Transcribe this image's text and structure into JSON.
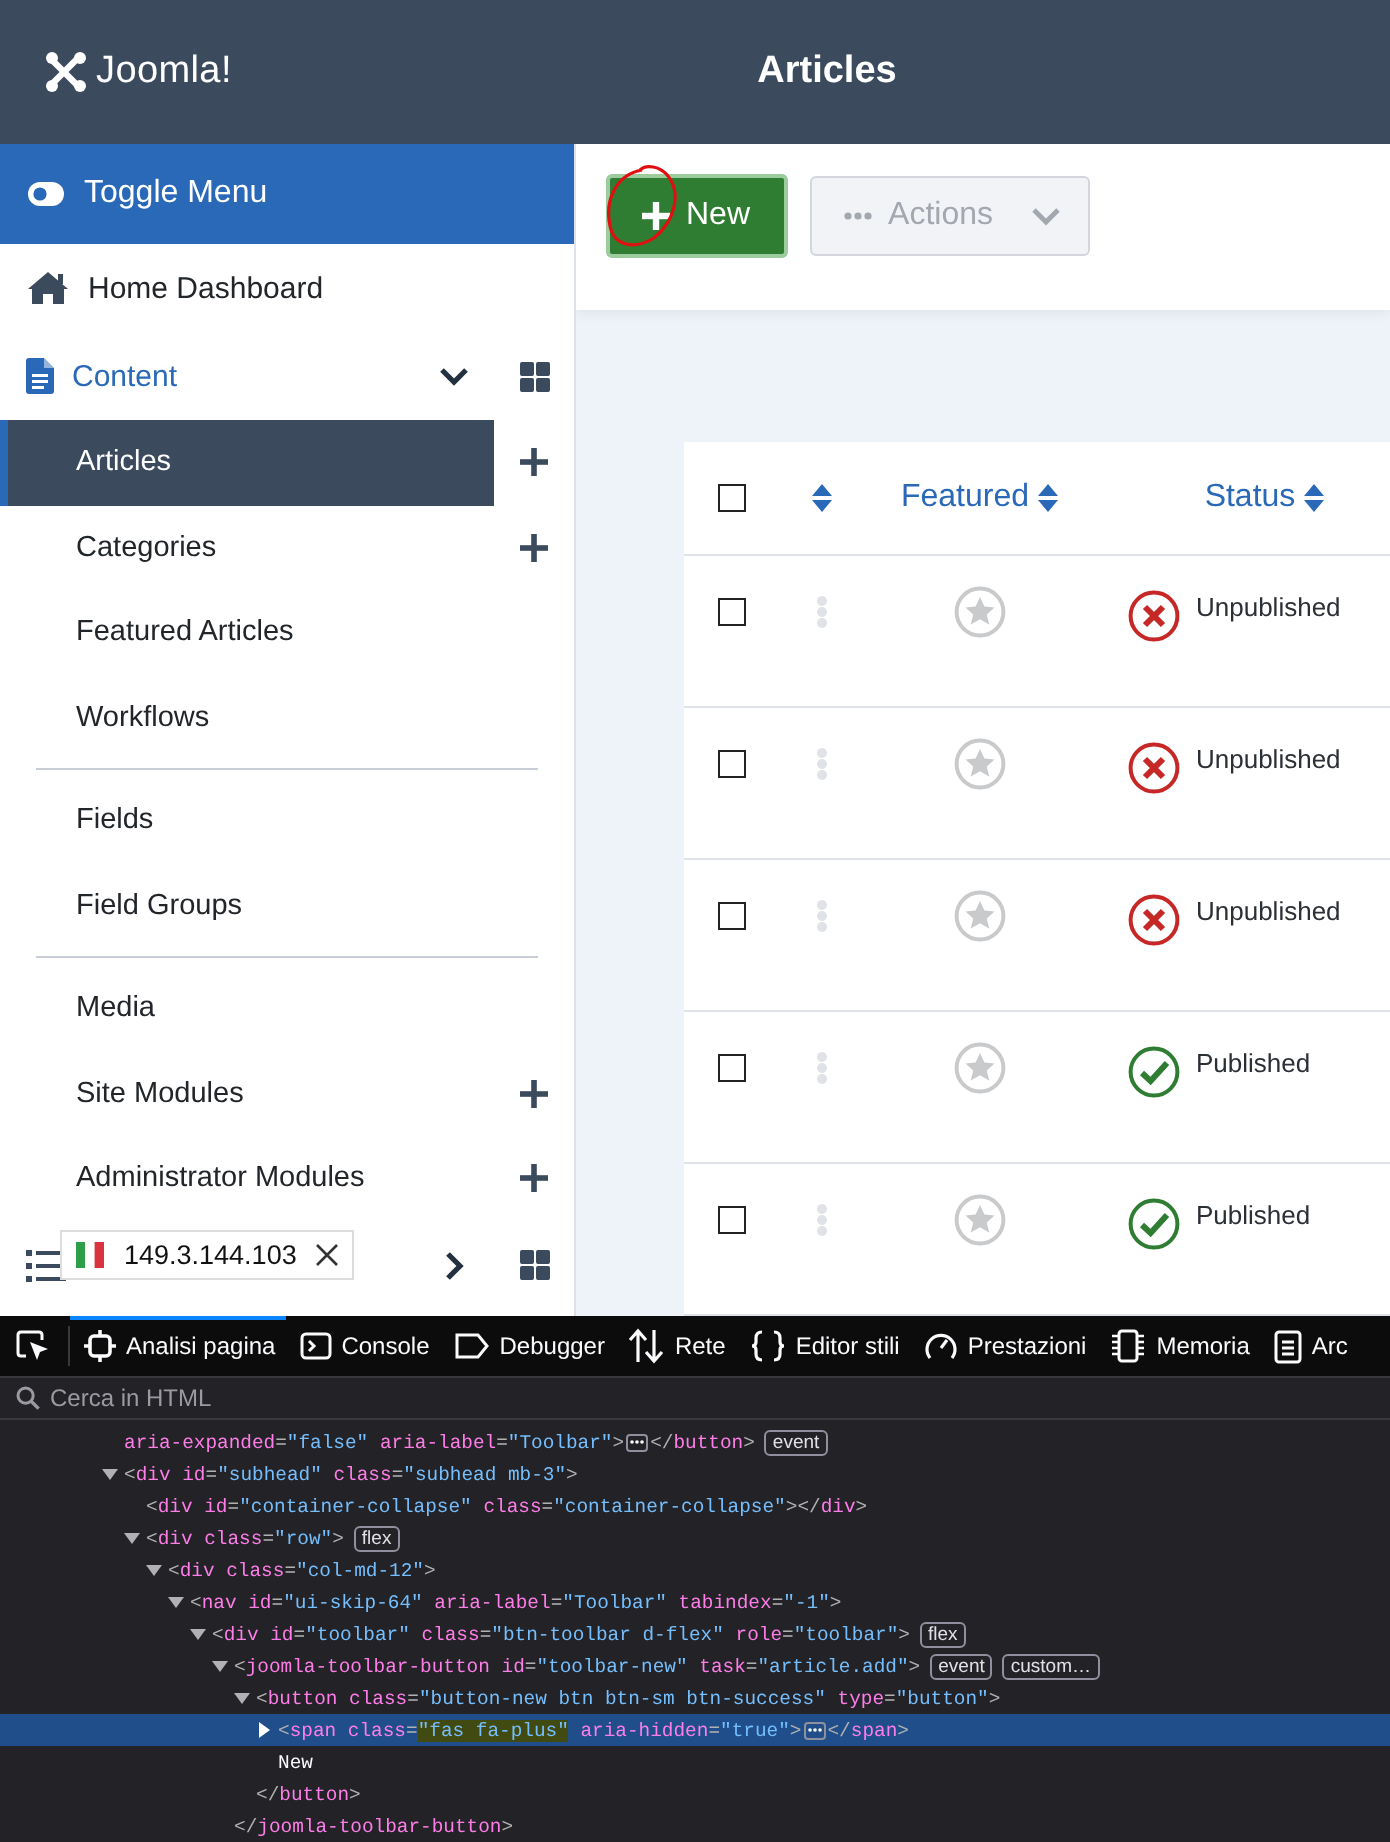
{
  "header": {
    "logo": "Joomla!",
    "title": "Articles"
  },
  "sidebar": {
    "toggle": "Toggle Menu",
    "items": [
      {
        "kind": "link",
        "label": "Home Dashboard",
        "selected": false
      },
      {
        "kind": "section",
        "label": "Content",
        "selected": false,
        "expanded": true,
        "dashboard": true,
        "children": [
          {
            "kind": "link",
            "label": "Articles",
            "selected": true,
            "add": true
          },
          {
            "kind": "link",
            "label": "Categories",
            "selected": false,
            "add": true
          },
          {
            "kind": "link",
            "label": "Featured Articles",
            "selected": false,
            "add": false
          },
          {
            "kind": "link",
            "label": "Workflows",
            "selected": false,
            "add": false
          },
          {
            "kind": "divider"
          },
          {
            "kind": "link",
            "label": "Fields",
            "selected": false,
            "add": false
          },
          {
            "kind": "link",
            "label": "Field Groups",
            "selected": false,
            "add": false
          },
          {
            "kind": "divider"
          },
          {
            "kind": "link",
            "label": "Media",
            "selected": false,
            "add": false
          },
          {
            "kind": "link",
            "label": "Site Modules",
            "selected": false,
            "add": true
          },
          {
            "kind": "link",
            "label": "Administrator Modules",
            "selected": false,
            "add": true
          }
        ]
      },
      {
        "kind": "section",
        "selected": false,
        "expanded": false,
        "dashboard": true
      }
    ]
  },
  "toolbar": {
    "buttons": [
      {
        "kind": "new",
        "label": "New",
        "annotated": true,
        "disabled": false
      },
      {
        "kind": "actions",
        "label": "Actions",
        "disabled": true
      }
    ]
  },
  "table": {
    "columns": [
      {
        "kind": "checkbox",
        "checked": false
      },
      {
        "kind": "sort"
      },
      {
        "kind": "sortable",
        "label": "Featured"
      },
      {
        "kind": "sortable",
        "label": "Status"
      }
    ],
    "rows": [
      {
        "checked": false,
        "featured": false,
        "status": {
          "kind": "unpublished",
          "label": "Unpublished"
        }
      },
      {
        "checked": false,
        "featured": false,
        "status": {
          "kind": "unpublished",
          "label": "Unpublished"
        }
      },
      {
        "checked": false,
        "featured": false,
        "status": {
          "kind": "unpublished",
          "label": "Unpublished"
        }
      },
      {
        "checked": false,
        "featured": false,
        "status": {
          "kind": "published",
          "label": "Published"
        }
      },
      {
        "checked": false,
        "featured": false,
        "status": {
          "kind": "published",
          "label": "Published"
        }
      }
    ]
  },
  "ip_popup": {
    "address": "149.3.144.103"
  },
  "devtools": {
    "tabs": [
      {
        "label": "Analisi pagina",
        "selected": true
      },
      {
        "label": "Console",
        "selected": false
      },
      {
        "label": "Debugger",
        "selected": false
      },
      {
        "label": "Rete",
        "selected": false
      },
      {
        "label": "Editor stili",
        "selected": false
      },
      {
        "label": "Prestazioni",
        "selected": false
      },
      {
        "label": "Memoria",
        "selected": false
      },
      {
        "label": "Arc",
        "selected": false
      }
    ],
    "search": {
      "placeholder": "Cerca in HTML"
    },
    "nodes": [
      {
        "kind": "element",
        "selected": false,
        "text": [
          {
            "text": "aria-expanded=\"false\" aria-label=\"Toolbar\">",
            "highlight": false
          }
        ],
        "more": true,
        "end": "</button>",
        "badges": [
          "event"
        ]
      },
      {
        "kind": "element",
        "selected": false,
        "expanded": true,
        "text": [
          {
            "text": "<div id=\"subhead\" class=\"subhead mb-3\">",
            "highlight": false
          }
        ],
        "children": [
          {
            "kind": "element",
            "selected": false,
            "text": [
              {
                "text": "<div id=\"container-collapse\" class=\"container-collapse\"></div>",
                "highlight": false
              }
            ]
          },
          {
            "kind": "element",
            "selected": false,
            "expanded": true,
            "text": [
              {
                "text": "<div class=\"row\">",
                "highlight": false
              }
            ],
            "badges": [
              "flex"
            ],
            "children": [
              {
                "kind": "element",
                "selected": false,
                "expanded": true,
                "text": [
                  {
                    "text": "<div class=\"col-md-12\">",
                    "highlight": false
                  }
                ],
                "children": [
                  {
                    "kind": "element",
                    "selected": false,
                    "expanded": true,
                    "text": [
                      {
                        "text": "<nav id=\"ui-skip-64\" aria-label=\"Toolbar\" tabindex=\"-1\">",
                        "highlight": false
                      }
                    ],
                    "children": [
                      {
                        "kind": "element",
                        "selected": false,
                        "expanded": true,
                        "text": [
                          {
                            "text": "<div id=\"toolbar\" class=\"btn-toolbar d-flex\" role=\"toolbar\">",
                            "highlight": false
                          }
                        ],
                        "badges": [
                          "flex"
                        ],
                        "children": [
                          {
                            "kind": "element",
                            "selected": false,
                            "expanded": true,
                            "text": [
                              {
                                "text": "<joomla-toolbar-button id=\"toolbar-new\" task=\"article.add\">",
                                "highlight": false
                              }
                            ],
                            "badges": [
                              "event",
                              "custom…"
                            ],
                            "children": [
                              {
                                "kind": "element",
                                "selected": false,
                                "expanded": true,
                                "text": [
                                  {
                                    "text": "<button class=\"button-new btn btn-sm btn-success\" type=\"button\">",
                                    "highlight": false
                                  }
                                ],
                                "children": [
                                  {
                                    "kind": "element",
                                    "selected": true,
                                    "expanded": false,
                                    "text": [
                                      {
                                        "text": "<span class=",
                                        "highlight": false
                                      },
                                      {
                                        "text": "\"fas fa-plus\"",
                                        "highlight": true
                                      },
                                      {
                                        "text": " aria-hidden=\"true\">",
                                        "highlight": false
                                      }
                                    ],
                                    "more": true,
                                    "end": "</span>"
                                  },
                                  {
                                    "kind": "text",
                                    "selected": false,
                                    "text": [
                                      {
                                        "text": "New",
                                        "highlight": false
                                      }
                                    ]
                                  }
                                ],
                                "close": "</button>"
                              }
                            ],
                            "close": "</joomla-toolbar-button>"
                          }
                        ]
                      }
                    ]
                  }
                ]
              }
            ]
          }
        ]
      }
    ]
  }
}
